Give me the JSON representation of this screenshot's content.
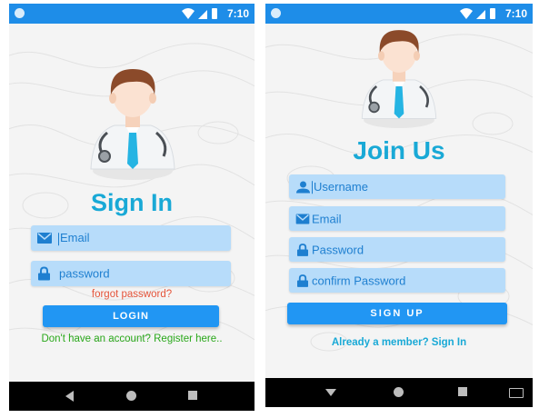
{
  "status_bar": {
    "time": "7:10"
  },
  "signin": {
    "title": "Sign In",
    "email_placeholder": "Email",
    "password_placeholder": "password",
    "forgot_label": "forgot password?",
    "login_label": "LOGIN",
    "register_label": "Don't have an account? Register here..",
    "colors": {
      "title": "#19a9d6",
      "forgot": "#e5553b",
      "register": "#2aa81b",
      "button": "#2196f3"
    }
  },
  "signup": {
    "title": "Join Us",
    "username_placeholder": "Username",
    "email_placeholder": "Email",
    "password_placeholder": "Password",
    "confirm_placeholder": "confirm Password",
    "signup_label": "SIGN UP",
    "member_label": "Already a member? Sign In",
    "colors": {
      "title": "#19a9d6",
      "member": "#19a9d6",
      "button": "#2196f3"
    }
  },
  "icons": [
    "doctor-avatar-icon",
    "mail-icon",
    "lock-icon",
    "person-icon",
    "wifi-icon",
    "signal-icon",
    "battery-icon",
    "back-icon",
    "home-icon",
    "recents-icon",
    "keyboard-icon"
  ]
}
